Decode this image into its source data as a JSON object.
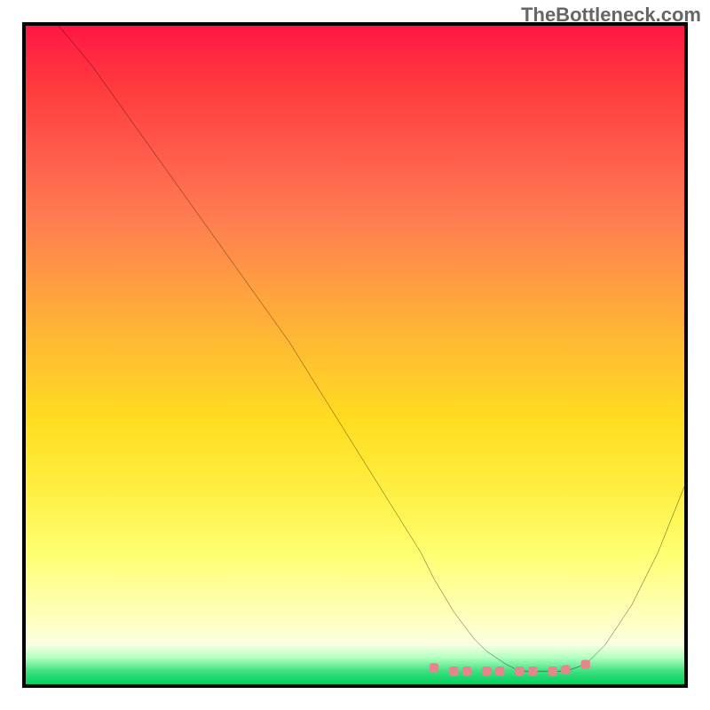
{
  "watermark": "TheBottleneck.com",
  "chart_data": {
    "type": "line",
    "title": "",
    "xlabel": "",
    "ylabel": "",
    "xlim": [
      0,
      100
    ],
    "ylim": [
      0,
      100
    ],
    "series": [
      {
        "name": "curve",
        "x": [
          5,
          10,
          15,
          20,
          25,
          30,
          35,
          40,
          45,
          50,
          55,
          60,
          62,
          65,
          68,
          70,
          73,
          75,
          78,
          80,
          82,
          85,
          88,
          92,
          96,
          100
        ],
        "y": [
          100,
          94,
          87,
          80,
          73,
          66,
          59,
          52,
          44,
          36,
          28,
          20,
          16,
          11,
          7,
          5,
          3,
          2,
          2,
          2,
          2,
          3,
          6,
          12,
          20,
          30
        ]
      }
    ],
    "markers": {
      "name": "low-points",
      "x": [
        62,
        65,
        67,
        70,
        72,
        75,
        77,
        80,
        82,
        85
      ],
      "y": [
        2.5,
        2,
        2,
        2,
        2,
        2,
        2,
        2,
        2.2,
        3
      ],
      "color": "#e8848c"
    },
    "gradient_colors": {
      "top": "#ff1744",
      "mid": "#ffd000",
      "bottom": "#00d060"
    }
  }
}
